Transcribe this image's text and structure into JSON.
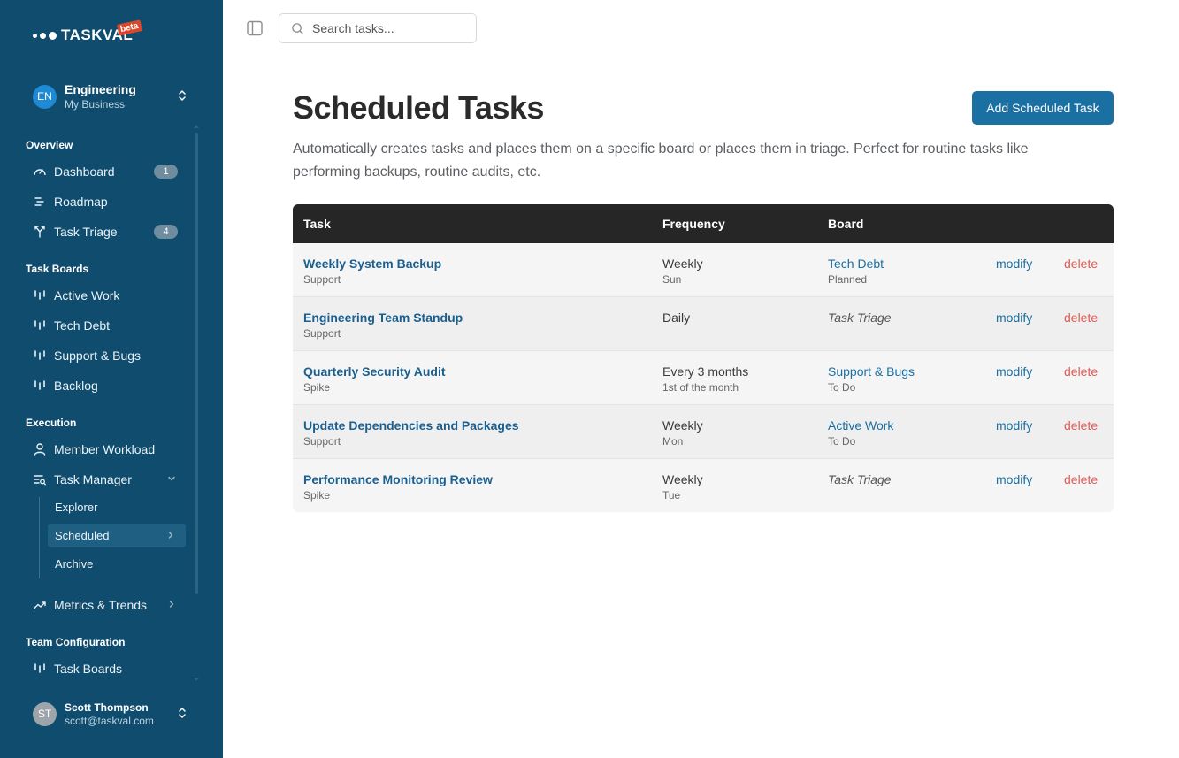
{
  "app": {
    "logo_text": "TASKVAL",
    "beta_label": "beta"
  },
  "workspace": {
    "initials": "EN",
    "name": "Engineering",
    "subtitle": "My Business"
  },
  "sidebar": {
    "overview_title": "Overview",
    "dashboard": {
      "label": "Dashboard",
      "badge": "1"
    },
    "roadmap": {
      "label": "Roadmap"
    },
    "triage": {
      "label": "Task Triage",
      "badge": "4"
    },
    "boards_title": "Task Boards",
    "boards": [
      {
        "label": "Active Work"
      },
      {
        "label": "Tech Debt"
      },
      {
        "label": "Support & Bugs"
      },
      {
        "label": "Backlog"
      }
    ],
    "execution_title": "Execution",
    "member_workload": {
      "label": "Member Workload"
    },
    "task_manager": {
      "label": "Task Manager"
    },
    "task_manager_items": [
      {
        "label": "Explorer"
      },
      {
        "label": "Scheduled"
      },
      {
        "label": "Archive"
      }
    ],
    "metrics": {
      "label": "Metrics & Trends"
    },
    "team_config_title": "Team Configuration",
    "task_boards_config": {
      "label": "Task Boards"
    }
  },
  "user": {
    "initials": "ST",
    "name": "Scott Thompson",
    "email": "scott@taskval.com"
  },
  "search": {
    "placeholder": "Search tasks..."
  },
  "main": {
    "title": "Scheduled Tasks",
    "add_button": "Add Scheduled Task",
    "description": "Automatically creates tasks and places them on a specific board or places them in triage. Perfect for routine tasks like performing backups, routine audits, etc."
  },
  "table": {
    "headers": {
      "task": "Task",
      "frequency": "Frequency",
      "board": "Board"
    },
    "modify_label": "modify",
    "delete_label": "delete",
    "rows": [
      {
        "name": "Weekly System Backup",
        "category": "Support",
        "frequency": "Weekly",
        "frequency_detail": "Sun",
        "board": "Tech Debt",
        "board_status": "Planned",
        "triage": false
      },
      {
        "name": "Engineering Team Standup",
        "category": "Support",
        "frequency": "Daily",
        "frequency_detail": "",
        "board": "Task Triage",
        "board_status": "",
        "triage": true
      },
      {
        "name": "Quarterly Security Audit",
        "category": "Spike",
        "frequency": "Every 3 months",
        "frequency_detail": "1st of the month",
        "board": "Support & Bugs",
        "board_status": "To Do",
        "triage": false
      },
      {
        "name": "Update Dependencies and Packages",
        "category": "Support",
        "frequency": "Weekly",
        "frequency_detail": "Mon",
        "board": "Active Work",
        "board_status": "To Do",
        "triage": false
      },
      {
        "name": "Performance Monitoring Review",
        "category": "Spike",
        "frequency": "Weekly",
        "frequency_detail": "Tue",
        "board": "Task Triage",
        "board_status": "",
        "triage": true
      }
    ]
  },
  "colors": {
    "sidebar_bg": "#0f4c6e",
    "accent": "#1a6fa3",
    "delete": "#e05a54",
    "table_header": "#262626"
  }
}
